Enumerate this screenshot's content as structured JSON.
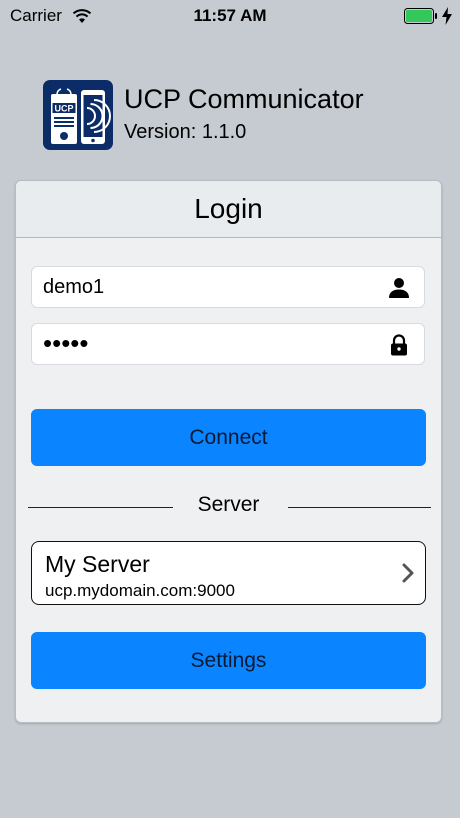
{
  "status_bar": {
    "carrier": "Carrier",
    "time": "11:57 AM",
    "battery_color": "#34c759"
  },
  "app": {
    "name": "UCP Communicator",
    "version": "Version: 1.1.0",
    "logo_text": "UCP",
    "logo_color": "#0b2c66"
  },
  "login": {
    "title": "Login",
    "username_value": "demo1",
    "password_value": "•••••",
    "username_icon": "person-icon",
    "password_icon": "lock-icon",
    "connect_label": "Connect"
  },
  "server": {
    "section_label": "Server",
    "name": "My Server",
    "address": "ucp.mydomain.com:9000",
    "chevron_icon": "chevron-right-icon"
  },
  "settings_label": "Settings",
  "colors": {
    "accent": "#0a84ff",
    "background": "#c6cbd2",
    "card": "#eef0f2"
  }
}
